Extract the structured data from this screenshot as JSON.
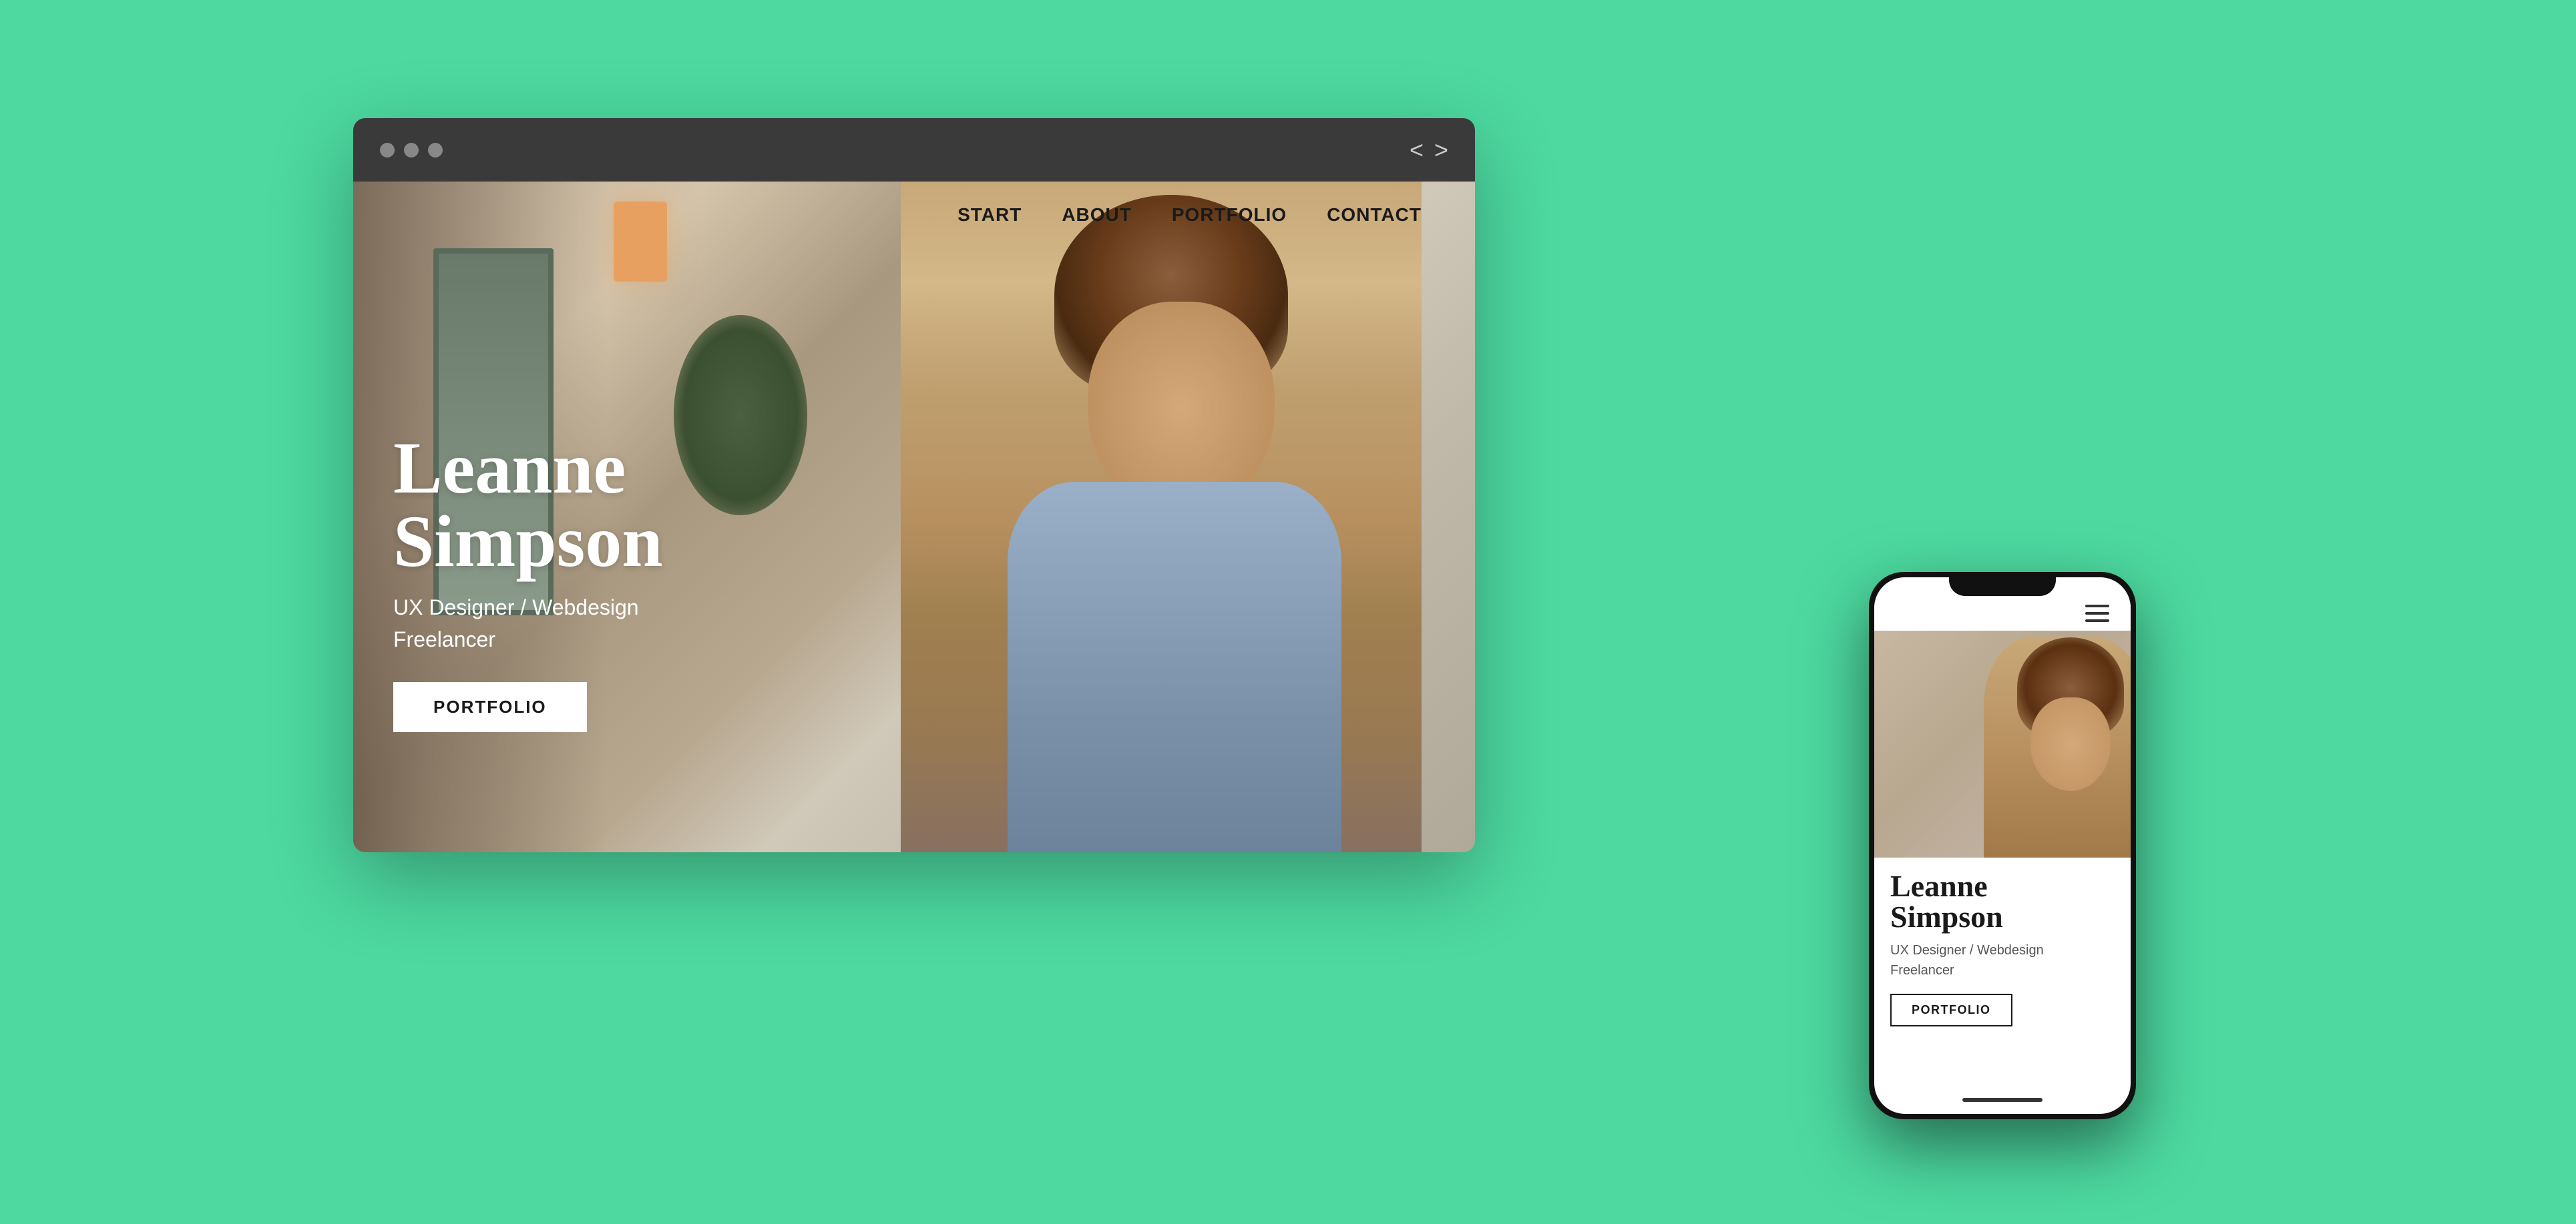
{
  "background_color": "#4dd9a0",
  "browser": {
    "dots": [
      "dot1",
      "dot2",
      "dot3"
    ],
    "nav_arrows": [
      "‹",
      "›"
    ],
    "nav_items": [
      "START",
      "ABOUT",
      "PORTFOLIO",
      "CONTACT"
    ],
    "hero": {
      "name_line1": "Leanne",
      "name_line2": "Simpson",
      "subtitle_line1": "UX Designer / Webdesign",
      "subtitle_line2": "Freelancer",
      "cta_label": "PORTFOLIO"
    }
  },
  "phone": {
    "menu_icon_label": "hamburger-menu",
    "hero": {
      "name_line1": "Leanne",
      "name_line2": "Simpson",
      "subtitle_line1": "UX Designer / Webdesign",
      "subtitle_line2": "Freelancer",
      "cta_label": "PORTFOLIO"
    }
  }
}
